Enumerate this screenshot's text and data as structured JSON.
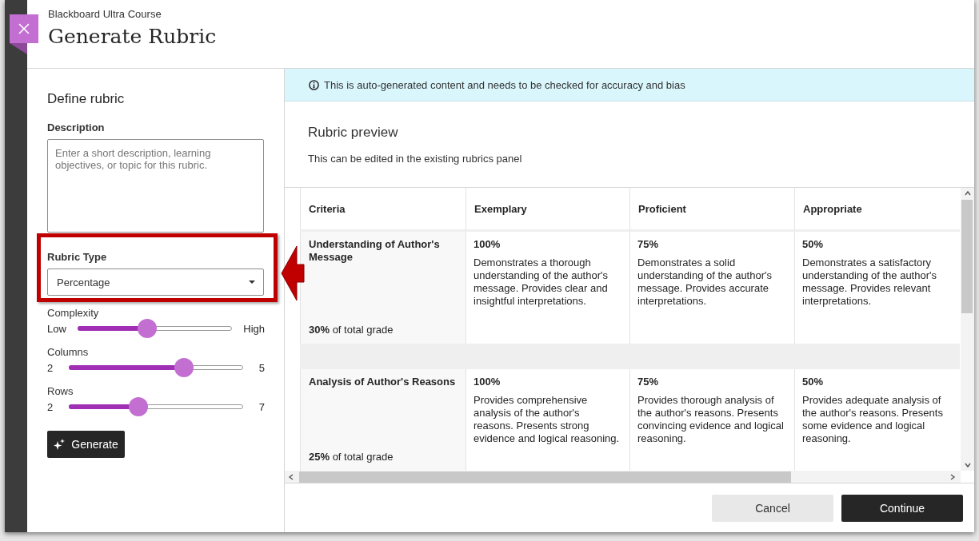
{
  "header": {
    "context": "Blackboard Ultra Course",
    "title": "Generate Rubric"
  },
  "form": {
    "heading": "Define rubric",
    "description": {
      "label": "Description",
      "placeholder": "Enter a short description, learning objectives, or topic for this rubric."
    },
    "rubric_type": {
      "label": "Rubric Type",
      "value": "Percentage"
    },
    "sliders": [
      {
        "label": "Complexity",
        "min_label": "Low",
        "max_label": "High",
        "level": 0.45,
        "kind": "inline"
      },
      {
        "label": "Columns",
        "min_label": "2",
        "max_label": "5",
        "level": 0.66,
        "kind": "stacked"
      },
      {
        "label": "Rows",
        "min_label": "2",
        "max_label": "7",
        "level": 0.4,
        "kind": "stacked"
      }
    ],
    "generate_button": "Generate"
  },
  "notice": "This is auto-generated content and needs to be checked for accuracy and bias",
  "preview": {
    "title": "Rubric preview",
    "subtitle": "This can be edited in the existing rubrics panel",
    "columns": [
      "Criteria",
      "Exemplary",
      "Proficient",
      "Appropriate"
    ],
    "rows": [
      {
        "cells": [
          {
            "kind": "criterion",
            "title": "Understanding of Author's Message",
            "weight": "**30%** of total grade"
          },
          {
            "kind": "level",
            "score": "100%",
            "description": "Demonstrates a thorough understanding of the author's message. Provides clear and insightful interpretations."
          },
          {
            "kind": "level",
            "score": "75%",
            "description": "Demonstrates a solid understanding of the author's message. Provides accurate interpretations."
          },
          {
            "kind": "level",
            "score": "50%",
            "description": "Demonstrates a satisfactory understanding of the author's message. Provides relevant interpretations."
          }
        ]
      },
      {
        "cells": [
          {
            "kind": "criterion",
            "title": "Analysis of Author's Reasons",
            "weight": "**25%** of total grade"
          },
          {
            "kind": "level",
            "score": "100%",
            "description": "Provides comprehensive analysis of the author's reasons. Presents strong evidence and logical reasoning."
          },
          {
            "kind": "level",
            "score": "75%",
            "description": "Provides thorough analysis of the author's reasons. Presents convincing evidence and logical reasoning."
          },
          {
            "kind": "level",
            "score": "50%",
            "description": "Provides adequate analysis of the author's reasons. Presents some evidence and logical reasoning."
          }
        ]
      }
    ]
  },
  "footer_buttons": [
    {
      "label": "Cancel",
      "kind": "secondary"
    },
    {
      "label": "Continue",
      "kind": "primary"
    }
  ]
}
